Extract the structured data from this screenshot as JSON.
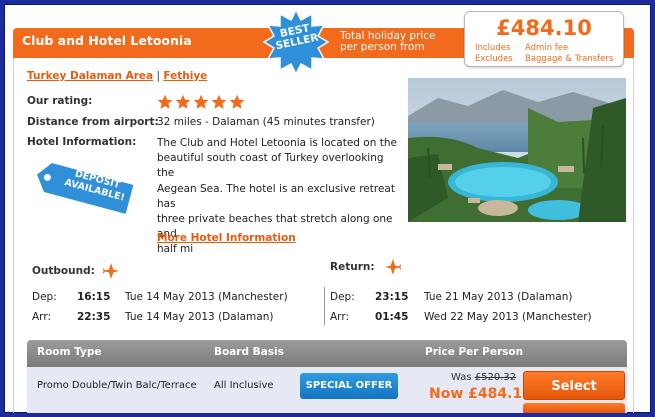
{
  "hotel": {
    "name": "Club and Hotel Letoonia",
    "badge": "BEST SELLER",
    "location": {
      "area": "Turkey Dalaman Area",
      "separator": "|",
      "town": "Fethiye"
    },
    "rating_label": "Our rating:",
    "rating_stars": 5,
    "distance_label": "Distance from airport:",
    "distance_value": "32 miles - Dalaman (45 minutes transfer)",
    "info_label": "Hotel Information:",
    "info_lines": [
      "The Club and Hotel Letoonia is located on the",
      "beautiful south coast of Turkey overlooking the",
      "Aegean Sea. The hotel is an exclusive retreat has",
      "three private beaches that stretch along one and",
      "half mi"
    ],
    "deposit_line1": "DEPOSIT",
    "deposit_line2": "AVAILABLE!",
    "more_info_link": "More Hotel Information"
  },
  "price": {
    "total_label_line1": "Total holiday price",
    "total_label_line2": "per person from",
    "total": "£484.10",
    "includes_key": "Includes",
    "includes_value": "Admin fee",
    "excludes_key": "Excludes",
    "excludes_value": "Baggage & Transfers"
  },
  "outbound": {
    "title": "Outbound:",
    "dep_label": "Dep:",
    "dep_time": "16:15",
    "dep_date": "Tue  14 May 2013 (Manchester)",
    "arr_label": "Arr:",
    "arr_time": "22:35",
    "arr_date": "Tue  14 May 2013 (Dalaman)"
  },
  "return": {
    "title": "Return:",
    "dep_label": "Dep:",
    "dep_time": "23:15",
    "dep_date": "Tue  21 May 2013 (Dalaman)",
    "arr_label": "Arr:",
    "arr_time": "01:45",
    "arr_date": "Wed  22 May 2013 (Manchester)"
  },
  "table": {
    "headers": [
      "Room Type",
      "Board Basis",
      "Price Per Person"
    ],
    "rows": [
      {
        "room": "Promo Double/Twin Balc/Terrace",
        "board": "All Inclusive",
        "special": "SPECIAL OFFER",
        "was_label": "Was",
        "was_price": "£520.32",
        "now_price": "Now £484.10",
        "select": "Select"
      }
    ]
  },
  "colors": {
    "accent": "#f26b1d",
    "frame": "#1c2d9b",
    "badge": "#2f8fd8",
    "special": "#1f86d1"
  },
  "icons": [
    "plane-icon",
    "star-icon"
  ]
}
